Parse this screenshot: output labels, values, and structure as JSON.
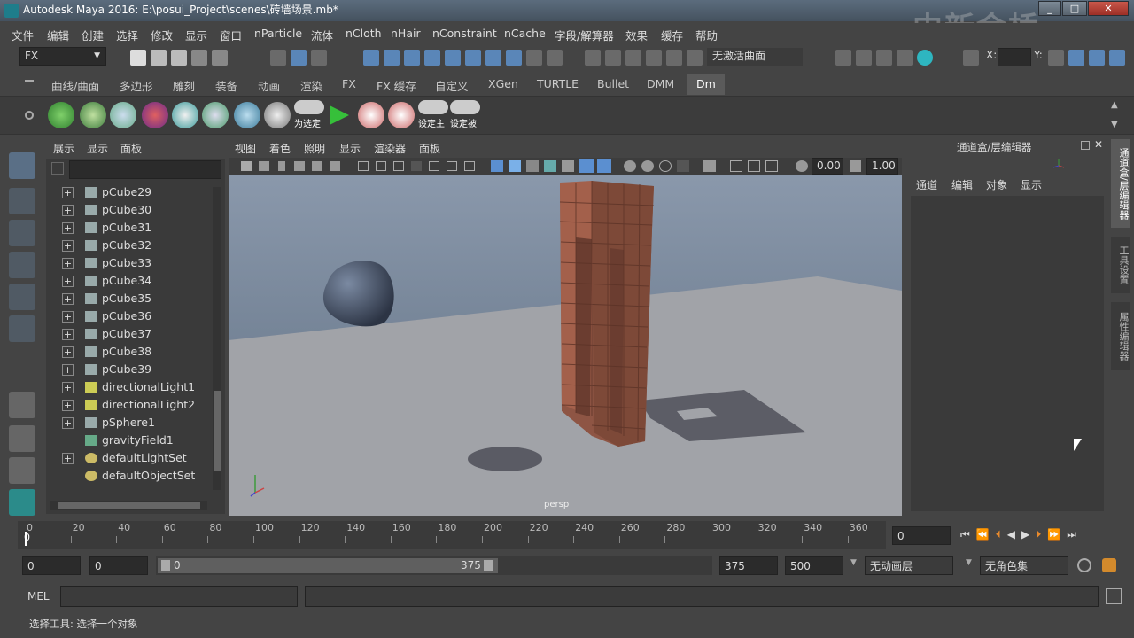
{
  "window": {
    "title": "Autodesk Maya 2016: E:\\posui_Project\\scenes\\砖墙场景.mb*",
    "watermark": "中新金桥"
  },
  "menubar": [
    "文件",
    "编辑",
    "创建",
    "选择",
    "修改",
    "显示",
    "窗口",
    "nParticle",
    "流体",
    "nCloth",
    "nHair",
    "nConstraint",
    "nCache",
    "字段/解算器",
    "效果",
    "缓存",
    "帮助"
  ],
  "status": {
    "mode": "FX",
    "live_surface": "无激活曲面",
    "x_label": "X:",
    "y_label": "Y:"
  },
  "shelf_tabs": [
    "曲线/曲面",
    "多边形",
    "雕刻",
    "装备",
    "动画",
    "渲染",
    "FX",
    "FX 缓存",
    "自定义",
    "XGen",
    "TURTLE",
    "Bullet",
    "DMM",
    "Dm"
  ],
  "shelf_labels": [
    "为选定",
    "设定主",
    "设定被"
  ],
  "outliner": {
    "menu": [
      "展示",
      "显示",
      "面板"
    ],
    "items": [
      {
        "label": "pCube29",
        "expand": true,
        "icon": "mesh-icon"
      },
      {
        "label": "pCube30",
        "expand": true,
        "icon": "mesh-icon"
      },
      {
        "label": "pCube31",
        "expand": true,
        "icon": "mesh-icon"
      },
      {
        "label": "pCube32",
        "expand": true,
        "icon": "mesh-icon"
      },
      {
        "label": "pCube33",
        "expand": true,
        "icon": "mesh-icon"
      },
      {
        "label": "pCube34",
        "expand": true,
        "icon": "mesh-icon"
      },
      {
        "label": "pCube35",
        "expand": true,
        "icon": "mesh-icon"
      },
      {
        "label": "pCube36",
        "expand": true,
        "icon": "mesh-icon"
      },
      {
        "label": "pCube37",
        "expand": true,
        "icon": "mesh-icon"
      },
      {
        "label": "pCube38",
        "expand": true,
        "icon": "mesh-icon"
      },
      {
        "label": "pCube39",
        "expand": true,
        "icon": "mesh-icon"
      },
      {
        "label": "directionalLight1",
        "expand": true,
        "icon": "light-icon"
      },
      {
        "label": "directionalLight2",
        "expand": true,
        "icon": "light-icon"
      },
      {
        "label": "pSphere1",
        "expand": true,
        "icon": "mesh-icon"
      },
      {
        "label": "gravityField1",
        "expand": false,
        "icon": "field-icon"
      },
      {
        "label": "defaultLightSet",
        "expand": true,
        "icon": "set-icon"
      },
      {
        "label": "defaultObjectSet",
        "expand": false,
        "icon": "set-icon"
      }
    ]
  },
  "viewport": {
    "menu": [
      "视图",
      "着色",
      "照明",
      "显示",
      "渲染器",
      "面板"
    ],
    "field_a": "0.00",
    "field_b": "1.00",
    "camera_label": "persp"
  },
  "channelbox": {
    "title": "通道盒/层编辑器",
    "menu": [
      "通道",
      "编辑",
      "对象",
      "显示"
    ]
  },
  "side_tabs": [
    "通道盒/层编辑器",
    "工具设置",
    "属性编辑器"
  ],
  "timeline": {
    "ticks": [
      0,
      20,
      40,
      60,
      80,
      100,
      120,
      140,
      160,
      180,
      200,
      220,
      240,
      260,
      280,
      300,
      320,
      340,
      360
    ],
    "current": "0",
    "current_field": "0"
  },
  "range": {
    "start_a": "0",
    "start_b": "0",
    "slider_start": "0",
    "slider_end": "375",
    "end_a": "375",
    "end_b": "500",
    "anim_layer": "无动画层",
    "char_set": "无角色集"
  },
  "cmdline": {
    "label": "MEL"
  },
  "help": {
    "text": "选择工具: 选择一个对象"
  }
}
